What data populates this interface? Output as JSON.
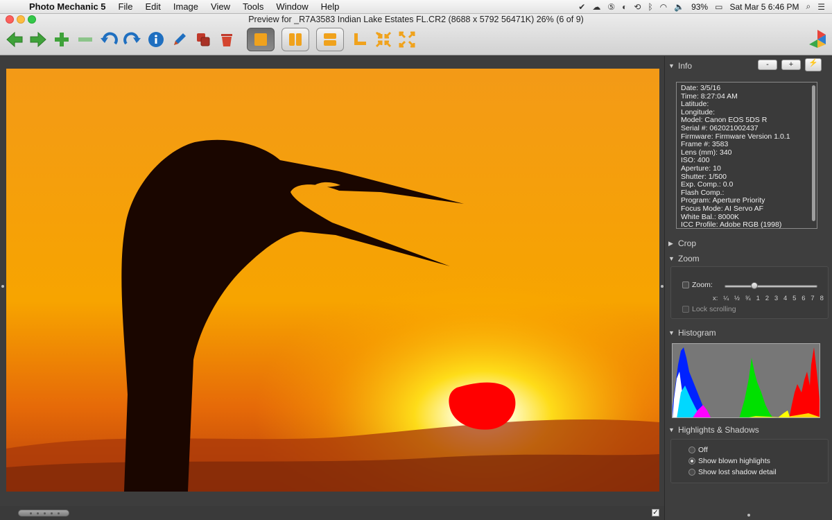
{
  "menubar": {
    "apple_icon": "apple-logo",
    "menus": [
      "Photo Mechanic 5",
      "File",
      "Edit",
      "Image",
      "View",
      "Tools",
      "Window",
      "Help"
    ],
    "battery": "93%",
    "clock": "Sat Mar 5  6:46 PM"
  },
  "window": {
    "title": "Preview for _R7A3583  Indian Lake Estates FL.CR2 (8688 x 5792 56471K) 26% (6 of 9)"
  },
  "toolbar": {
    "icons": [
      "arrow-left-icon",
      "arrow-right-icon",
      "plus-icon",
      "minus-icon",
      "rotate-left-icon",
      "rotate-right-icon",
      "info-icon",
      "pen-icon",
      "copy-icon",
      "trash-icon",
      "single-view-icon",
      "split-vertical-icon",
      "split-horizontal-icon",
      "crop-corner-icon",
      "shrink-icon",
      "expand-icon"
    ]
  },
  "panel": {
    "info": {
      "title": "Info",
      "buttons": [
        "-",
        "+",
        "⚡"
      ],
      "lines": [
        "Date: 3/5/16",
        "Time: 8:27:04 AM",
        "Latitude:",
        "Longitude:",
        "Model: Canon EOS 5DS R",
        "Serial #: 062021002437",
        "Firmware: Firmware Version 1.0.1",
        "Frame #: 3583",
        "Lens (mm): 340",
        "ISO: 400",
        "Aperture: 10",
        "Shutter: 1/500",
        "Exp. Comp.: 0.0",
        "Flash Comp.:",
        "Program: Aperture Priority",
        "Focus Mode: AI Servo AF",
        "White Bal.: 8000K",
        "ICC Profile: Adobe RGB (1998)"
      ]
    },
    "crop": {
      "title": "Crop"
    },
    "zoom": {
      "title": "Zoom",
      "checkbox_label": "Zoom:",
      "ticks_prefix": "x:",
      "ticks": [
        "¼",
        "½",
        "¾",
        "1",
        "2",
        "3",
        "4",
        "5",
        "6",
        "7",
        "8"
      ],
      "lock_label": "Lock scrolling"
    },
    "histogram": {
      "title": "Histogram"
    },
    "highlights": {
      "title": "Highlights & Shadows",
      "options": [
        {
          "label": "Off",
          "selected": false
        },
        {
          "label": "Show blown highlights",
          "selected": true
        },
        {
          "label": "Show lost shadow detail",
          "selected": false
        }
      ]
    }
  },
  "colors": {
    "accent_orange": "#f0a21c",
    "blown_highlight": "#ff0000"
  }
}
